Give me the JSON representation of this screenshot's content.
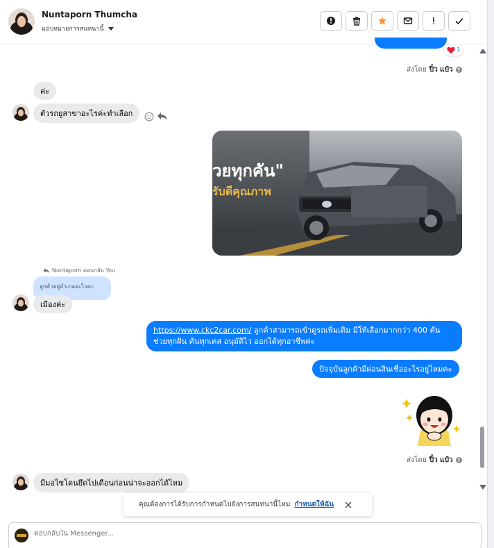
{
  "header": {
    "contact_name": "Nuntaporn Thumcha",
    "assign_label": "มอบหมายการสนทนานี้",
    "toolbar": [
      {
        "name": "spam-button",
        "icon": "alert-circle-icon"
      },
      {
        "name": "delete-button",
        "icon": "trash-icon"
      },
      {
        "name": "star-button",
        "icon": "star-icon"
      },
      {
        "name": "mark-unread-button",
        "icon": "envelope-icon"
      },
      {
        "name": "follow-up-button",
        "icon": "exclamation-icon"
      },
      {
        "name": "done-button",
        "icon": "check-icon"
      }
    ]
  },
  "messages": {
    "reaction_count": "1",
    "sent_by_prefix": "ส่งโดย",
    "sent_by_name": "ปิ๋ว แป๋ว",
    "in_1": "ค่ะ",
    "in_2": "ตัวรถยูสาขาอะไรค่ะทำเลือก",
    "reply_meta": "Nuntaporn ตอบกลับ You",
    "quoted_text": "ลูกค้าอยู่อำเภออะไรคะ",
    "in_3": "เมืองค่ะ",
    "link_url": "https://www.ckc2car.com/",
    "link_text": " ลูกค้าสามารถเข้าดูรถเพิ่มเติม มีให้เลือกมากกว่า 400 คัน ช่วยทุกฝัน คันทุกเคส อนุมัติไว ออกได้ทุกอาชีพค่ะ",
    "out_2": "ปัจจุบันลูกค้ามีผ่อนสินเชื่ออะไรอยู่ไหมคะ",
    "in_4": "มีมอไซโดนยึดไปเดือนก่อนน่าจะออกได้ไหม",
    "image_caption_1": "วยทุกคัน\"",
    "image_caption_2": "รับตีคุณภาพ"
  },
  "notice": {
    "text": "คุณต้องการได้รับการกำหนดไปยังการสนทนานี้ไหม",
    "link": "กำหนดให้ฉัน"
  },
  "composer": {
    "placeholder": "ตอบกลับใน Messenger..."
  },
  "colors": {
    "accent": "#0a7cff",
    "incoming_bubble": "#e9eaec",
    "quoted_bubble": "#cfe3ff",
    "star": "#f7923a"
  }
}
